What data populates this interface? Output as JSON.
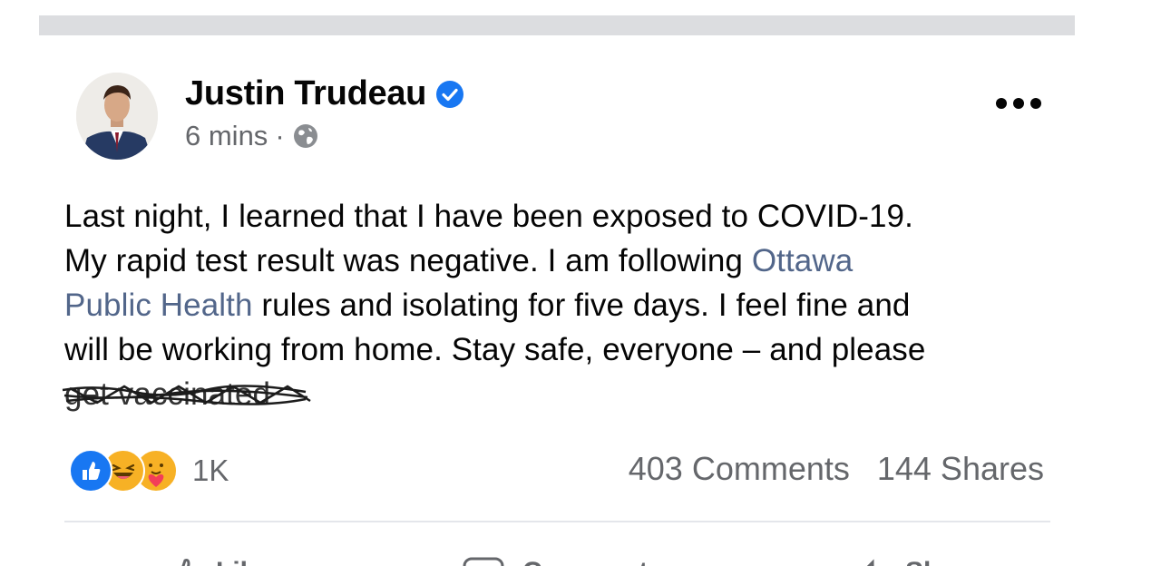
{
  "post": {
    "author": "Justin Trudeau",
    "verified": true,
    "time": "6 mins",
    "separator": "·",
    "privacy_icon": "globe-icon",
    "text": {
      "line1": "Last night, I learned that I have been exposed to COVID-19.",
      "line2_pre": "My rapid test result was negative. I am following ",
      "link_part1": "Ottawa",
      "link_part2": "Public Health",
      "line3_post": " rules and isolating for five days. I feel fine and",
      "line4": "will be working from home. Stay safe, everyone – and please",
      "struck": "get vaccinated"
    }
  },
  "engagement": {
    "reactions": [
      "like-icon",
      "haha-icon",
      "care-icon"
    ],
    "reaction_count": "1K",
    "comments": "403 Comments",
    "shares": "144 Shares"
  },
  "actions": [
    {
      "icon": "like-icon",
      "label": "Like"
    },
    {
      "icon": "comment-icon",
      "label": "Comment"
    },
    {
      "icon": "share-icon",
      "label": "Share"
    }
  ],
  "colors": {
    "link": "#52668a",
    "verified": "#1877f2",
    "secondary_text": "#65676b",
    "like": "#1877f2",
    "haha": "#f7b125"
  }
}
